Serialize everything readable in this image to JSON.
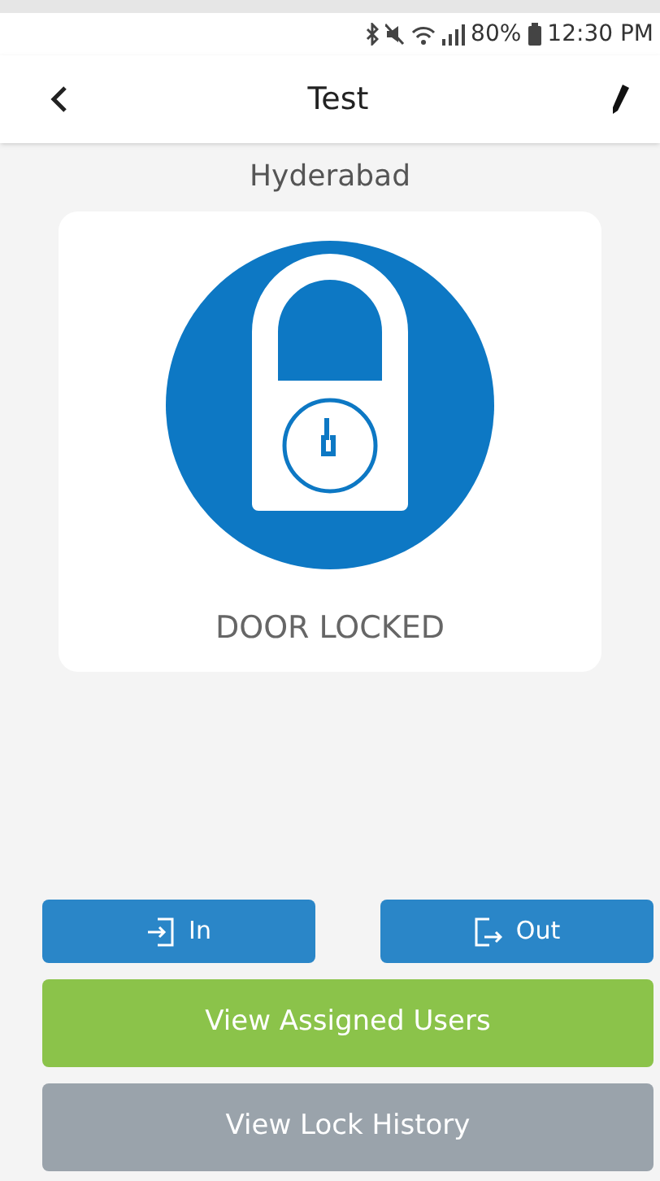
{
  "status_bar": {
    "battery": "80%",
    "time": "12:30 PM"
  },
  "header": {
    "title": "Test"
  },
  "location": "Hyderabad",
  "lock": {
    "locked": true,
    "status": "DOOR LOCKED"
  },
  "actions": [
    {
      "kind": "in",
      "label": "In"
    },
    {
      "kind": "out",
      "label": "Out"
    }
  ],
  "buttons": [
    {
      "kind": "green",
      "label": "View Assigned Users"
    },
    {
      "kind": "gray",
      "label": "View Lock History"
    }
  ]
}
